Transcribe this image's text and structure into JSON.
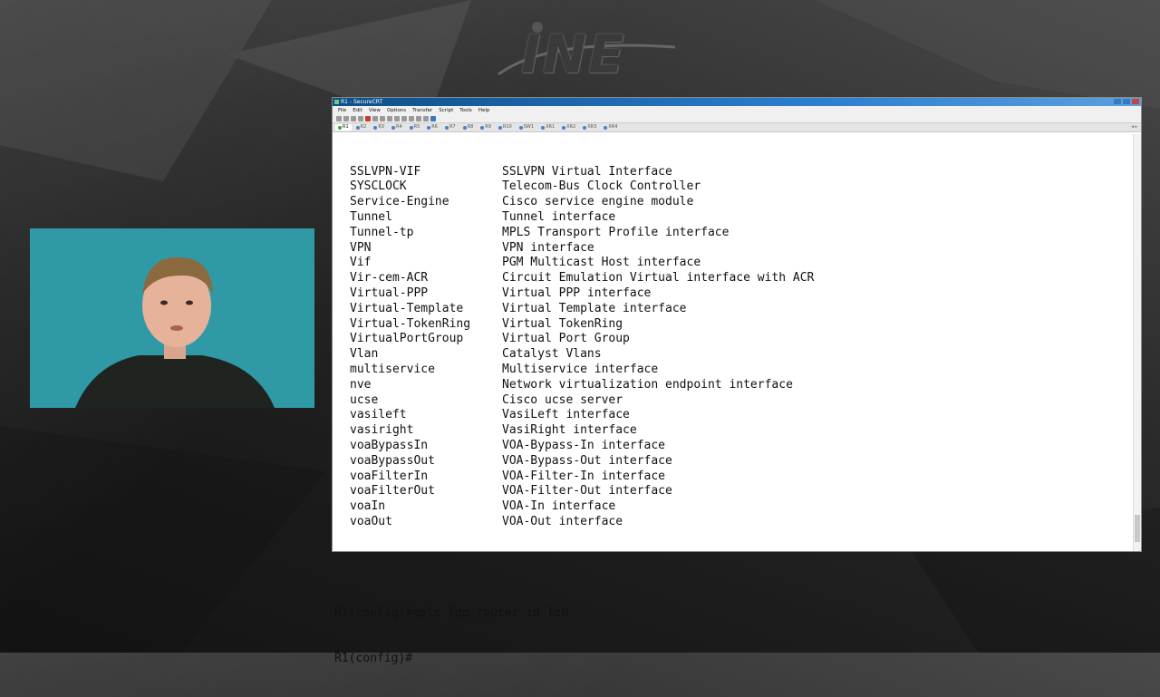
{
  "logo": {
    "text": "INE"
  },
  "window": {
    "title": "R1 - SecureCRT",
    "menu": [
      "File",
      "Edit",
      "View",
      "Options",
      "Transfer",
      "Script",
      "Tools",
      "Help"
    ],
    "tabs": [
      "R1",
      "R2",
      "R3",
      "R4",
      "R5",
      "R6",
      "R7",
      "R8",
      "R9",
      "R10",
      "SW1",
      "XR1",
      "XR2",
      "XR3",
      "XR4"
    ]
  },
  "terminal": {
    "interfaces": [
      {
        "name": "SSLVPN-VIF",
        "desc": "SSLVPN Virtual Interface"
      },
      {
        "name": "SYSCLOCK",
        "desc": "Telecom-Bus Clock Controller"
      },
      {
        "name": "Service-Engine",
        "desc": "Cisco service engine module"
      },
      {
        "name": "Tunnel",
        "desc": "Tunnel interface"
      },
      {
        "name": "Tunnel-tp",
        "desc": "MPLS Transport Profile interface"
      },
      {
        "name": "VPN",
        "desc": "VPN interface"
      },
      {
        "name": "Vif",
        "desc": "PGM Multicast Host interface"
      },
      {
        "name": "Vir-cem-ACR",
        "desc": "Circuit Emulation Virtual interface with ACR"
      },
      {
        "name": "Virtual-PPP",
        "desc": "Virtual PPP interface"
      },
      {
        "name": "Virtual-Template",
        "desc": "Virtual Template interface"
      },
      {
        "name": "Virtual-TokenRing",
        "desc": "Virtual TokenRing"
      },
      {
        "name": "VirtualPortGroup",
        "desc": "Virtual Port Group"
      },
      {
        "name": "Vlan",
        "desc": "Catalyst Vlans"
      },
      {
        "name": "multiservice",
        "desc": "Multiservice interface"
      },
      {
        "name": "nve",
        "desc": "Network virtualization endpoint interface"
      },
      {
        "name": "ucse",
        "desc": "Cisco ucse server"
      },
      {
        "name": "vasileft",
        "desc": "VasiLeft interface"
      },
      {
        "name": "vasiright",
        "desc": "VasiRight interface"
      },
      {
        "name": "voaBypassIn",
        "desc": "VOA-Bypass-In interface"
      },
      {
        "name": "voaBypassOut",
        "desc": "VOA-Bypass-Out interface"
      },
      {
        "name": "voaFilterIn",
        "desc": "VOA-Filter-In interface"
      },
      {
        "name": "voaFilterOut",
        "desc": "VOA-Filter-Out interface"
      },
      {
        "name": "voaIn",
        "desc": "VOA-In interface"
      },
      {
        "name": "voaOut",
        "desc": "VOA-Out interface"
      }
    ],
    "command_line": "R1(config)#mpls ldp router-id lo0",
    "prompt_line": "R1(config)#"
  }
}
